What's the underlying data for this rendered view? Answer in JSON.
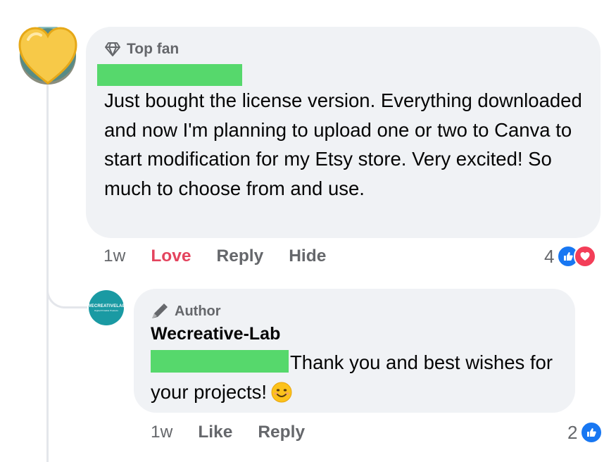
{
  "comment": {
    "avatar_icon": "yellow-heart-icon",
    "badge_icon": "diamond-icon",
    "badge_label": "Top fan",
    "text": "Just bought the license version.  Everything downloaded and now I'm planning to upload one or two to Canva to start modification for my Etsy store.  Very excited!  So much to choose from and use.",
    "time": "1w",
    "actions": {
      "love": "Love",
      "reply": "Reply",
      "hide": "Hide"
    },
    "reaction_count": "4",
    "reaction_icons": [
      "like-icon",
      "love-icon"
    ]
  },
  "reply": {
    "avatar_text": "WECREATIVELAB",
    "avatar_subtext": "Digital Printable Products",
    "badge_icon": "pen-icon",
    "badge_label": "Author",
    "author_name": "Wecreative-Lab",
    "text": "Thank you and best wishes for your projects!",
    "emoji": "smiling-face-icon",
    "time": "1w",
    "actions": {
      "like": "Like",
      "reply": "Reply"
    },
    "reaction_count": "2",
    "reaction_icons": [
      "like-icon"
    ]
  },
  "colors": {
    "bubble_bg": "#f0f2f5",
    "love_accent": "#e4445e",
    "like_blue": "#1877f2",
    "redaction_green": "#56d86c"
  }
}
